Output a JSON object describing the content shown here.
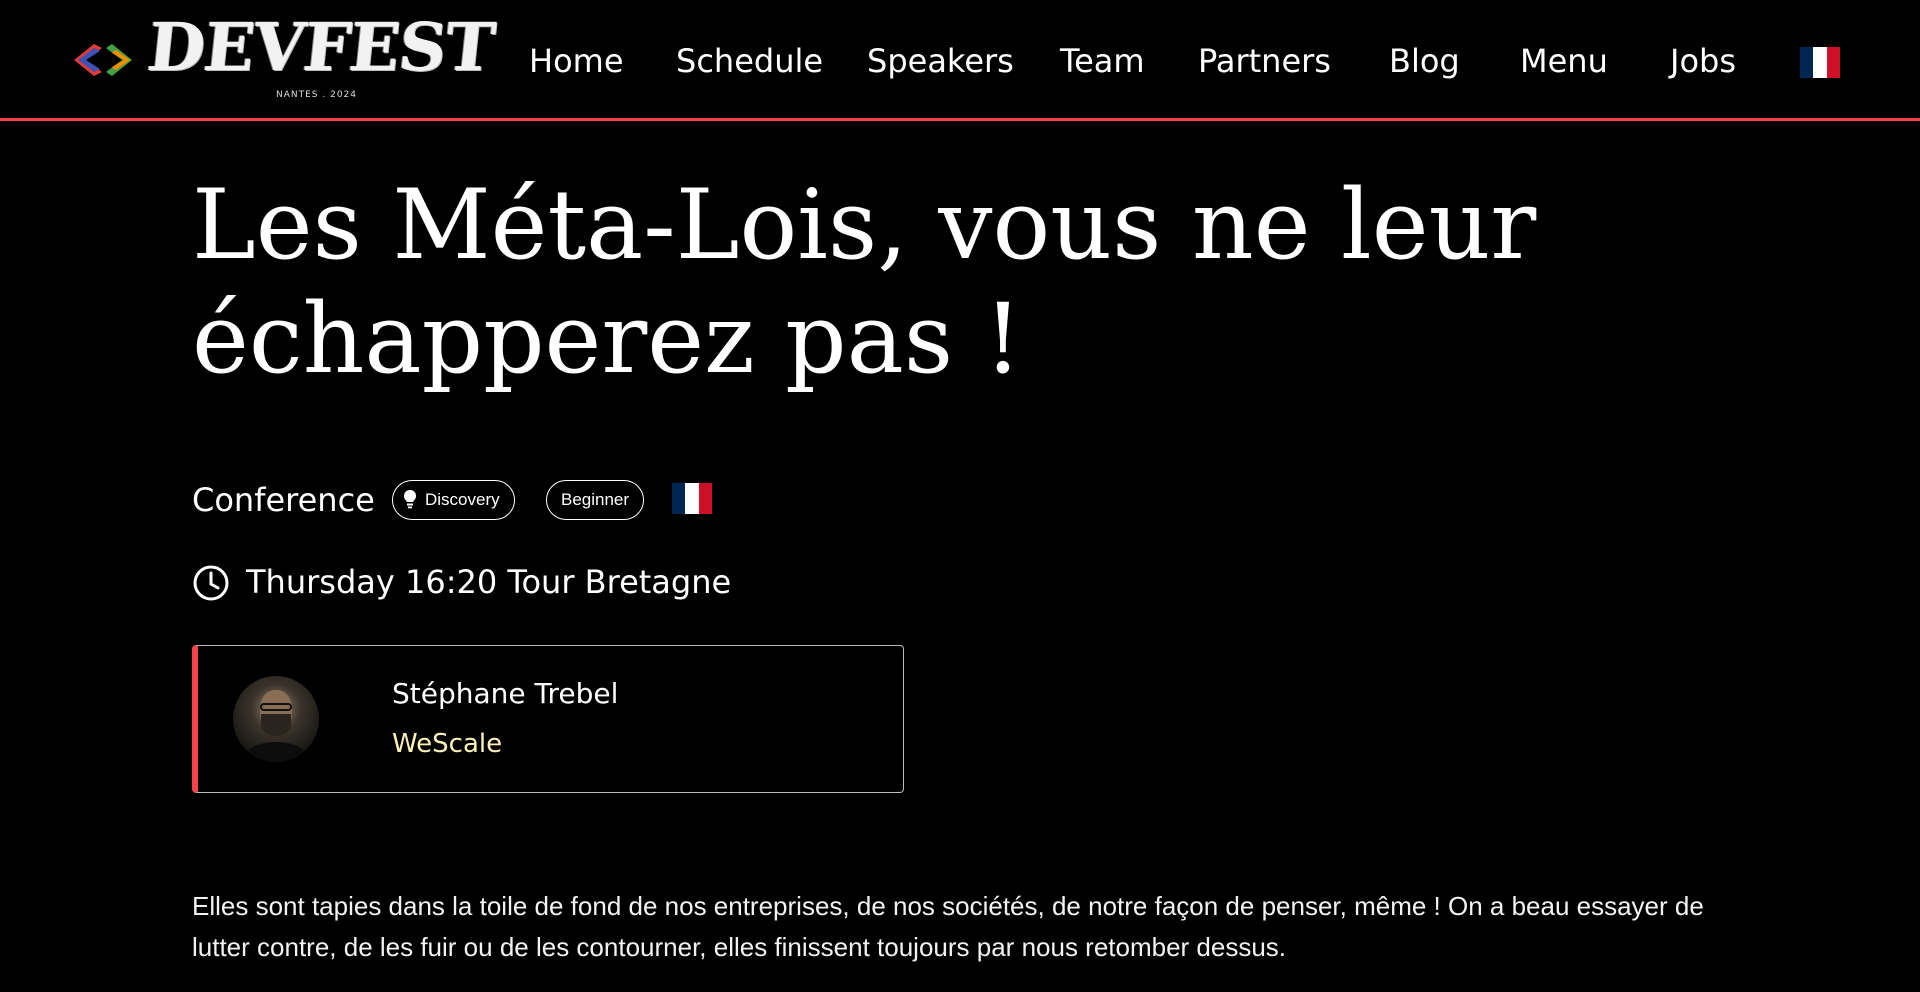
{
  "colors": {
    "background": "#000000",
    "accent": "#f4434b",
    "company": "#fdf1b8",
    "text": "#ffffff"
  },
  "logo": {
    "wordmark": "DEVFEST",
    "subtitle": "NANTES . 2024"
  },
  "nav": {
    "items": [
      {
        "label": "Home"
      },
      {
        "label": "Schedule"
      },
      {
        "label": "Speakers"
      },
      {
        "label": "Team"
      },
      {
        "label": "Partners"
      },
      {
        "label": "Blog"
      },
      {
        "label": "Menu"
      },
      {
        "label": "Jobs"
      }
    ],
    "language_icon": "french-flag-icon"
  },
  "session": {
    "title": "Les Méta-Lois, vous ne leur échapperez pas !",
    "format": "Conference",
    "category": {
      "label": "Discovery",
      "icon": "lightbulb-icon"
    },
    "level": "Beginner",
    "language_icon": "french-flag-icon",
    "schedule": {
      "icon": "clock-icon",
      "text": "Thursday 16:20 Tour Bretagne"
    },
    "speaker": {
      "name": "Stéphane Trebel",
      "company": "WeScale"
    },
    "abstract": "Elles sont tapies dans la toile de fond de nos entreprises, de nos sociétés, de notre façon de penser, même ! On a beau essayer de lutter contre, de les fuir ou de les contourner, elles finissent toujours par nous retomber dessus."
  }
}
